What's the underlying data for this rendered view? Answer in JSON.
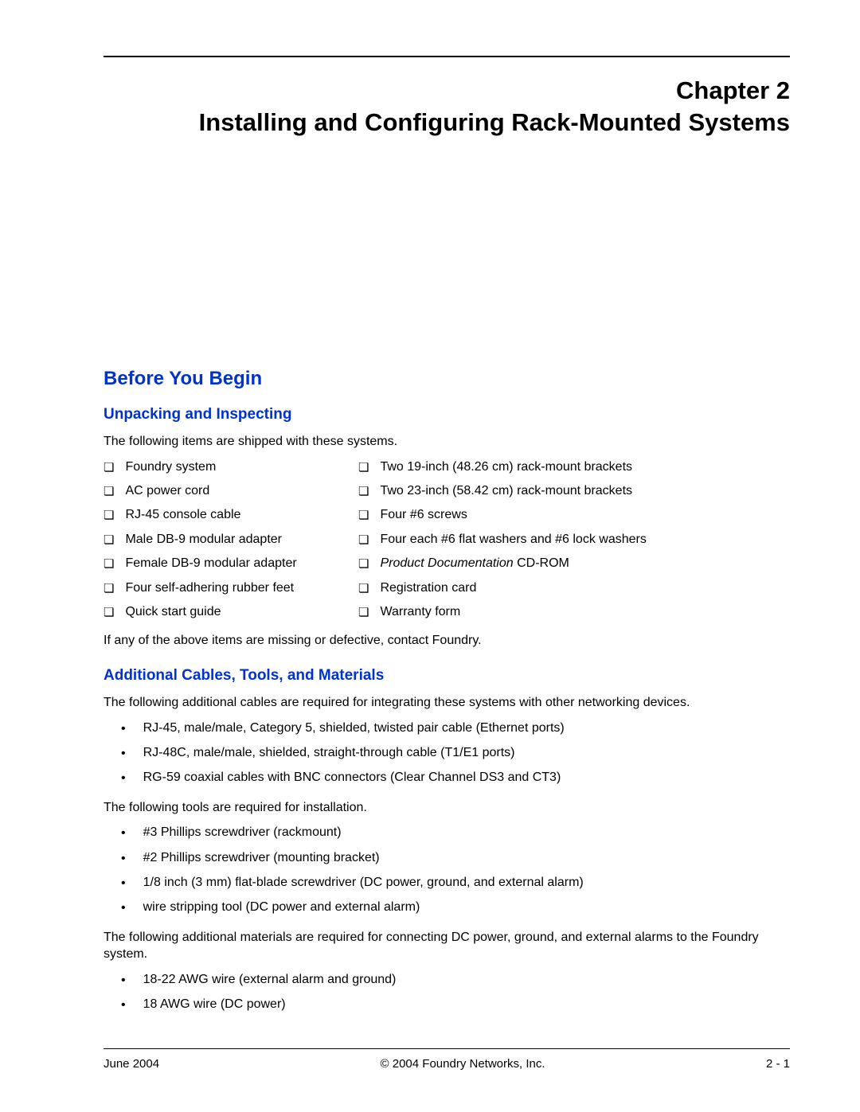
{
  "chapter": {
    "number": "Chapter 2",
    "title": "Installing and Configuring Rack-Mounted Systems"
  },
  "section1": {
    "heading": "Before You Begin",
    "sub1": {
      "heading": "Unpacking and Inspecting",
      "intro": "The following items are shipped with these systems.",
      "left": [
        "Foundry system",
        "AC power cord",
        "RJ-45 console cable",
        "Male DB-9 modular adapter",
        "Female DB-9 modular adapter",
        "Four self-adhering rubber feet",
        "Quick start guide"
      ],
      "right": [
        "Two 19-inch (48.26 cm) rack-mount brackets",
        "Two 23-inch (58.42 cm) rack-mount brackets",
        "Four #6 screws",
        "Four each #6 flat washers and #6 lock washers",
        "",
        "Registration card",
        "Warranty form"
      ],
      "right_special": {
        "italic": "Product Documentation",
        "rest": " CD-ROM"
      },
      "outro": "If any of the above items are missing or defective, contact Foundry."
    },
    "sub2": {
      "heading": "Additional Cables, Tools, and Materials",
      "p1": "The following additional cables are required for integrating these systems with other networking devices.",
      "cables": [
        "RJ-45, male/male, Category 5, shielded, twisted pair cable (Ethernet ports)",
        "RJ-48C, male/male, shielded, straight-through cable (T1/E1 ports)",
        "RG-59 coaxial cables with BNC connectors (Clear Channel DS3 and CT3)"
      ],
      "p2": "The following tools are required for installation.",
      "tools": [
        "#3 Phillips screwdriver (rackmount)",
        "#2 Phillips screwdriver (mounting bracket)",
        "1/8 inch (3 mm) flat-blade screwdriver (DC power, ground, and external alarm)",
        "wire stripping tool (DC power and external alarm)"
      ],
      "p3": "The following additional materials are required for connecting DC power, ground, and external alarms to the Foundry system.",
      "materials": [
        "18-22 AWG wire (external alarm and ground)",
        "18 AWG wire (DC power)"
      ]
    }
  },
  "footer": {
    "left": "June 2004",
    "center": "© 2004 Foundry Networks, Inc.",
    "right": "2 - 1"
  }
}
